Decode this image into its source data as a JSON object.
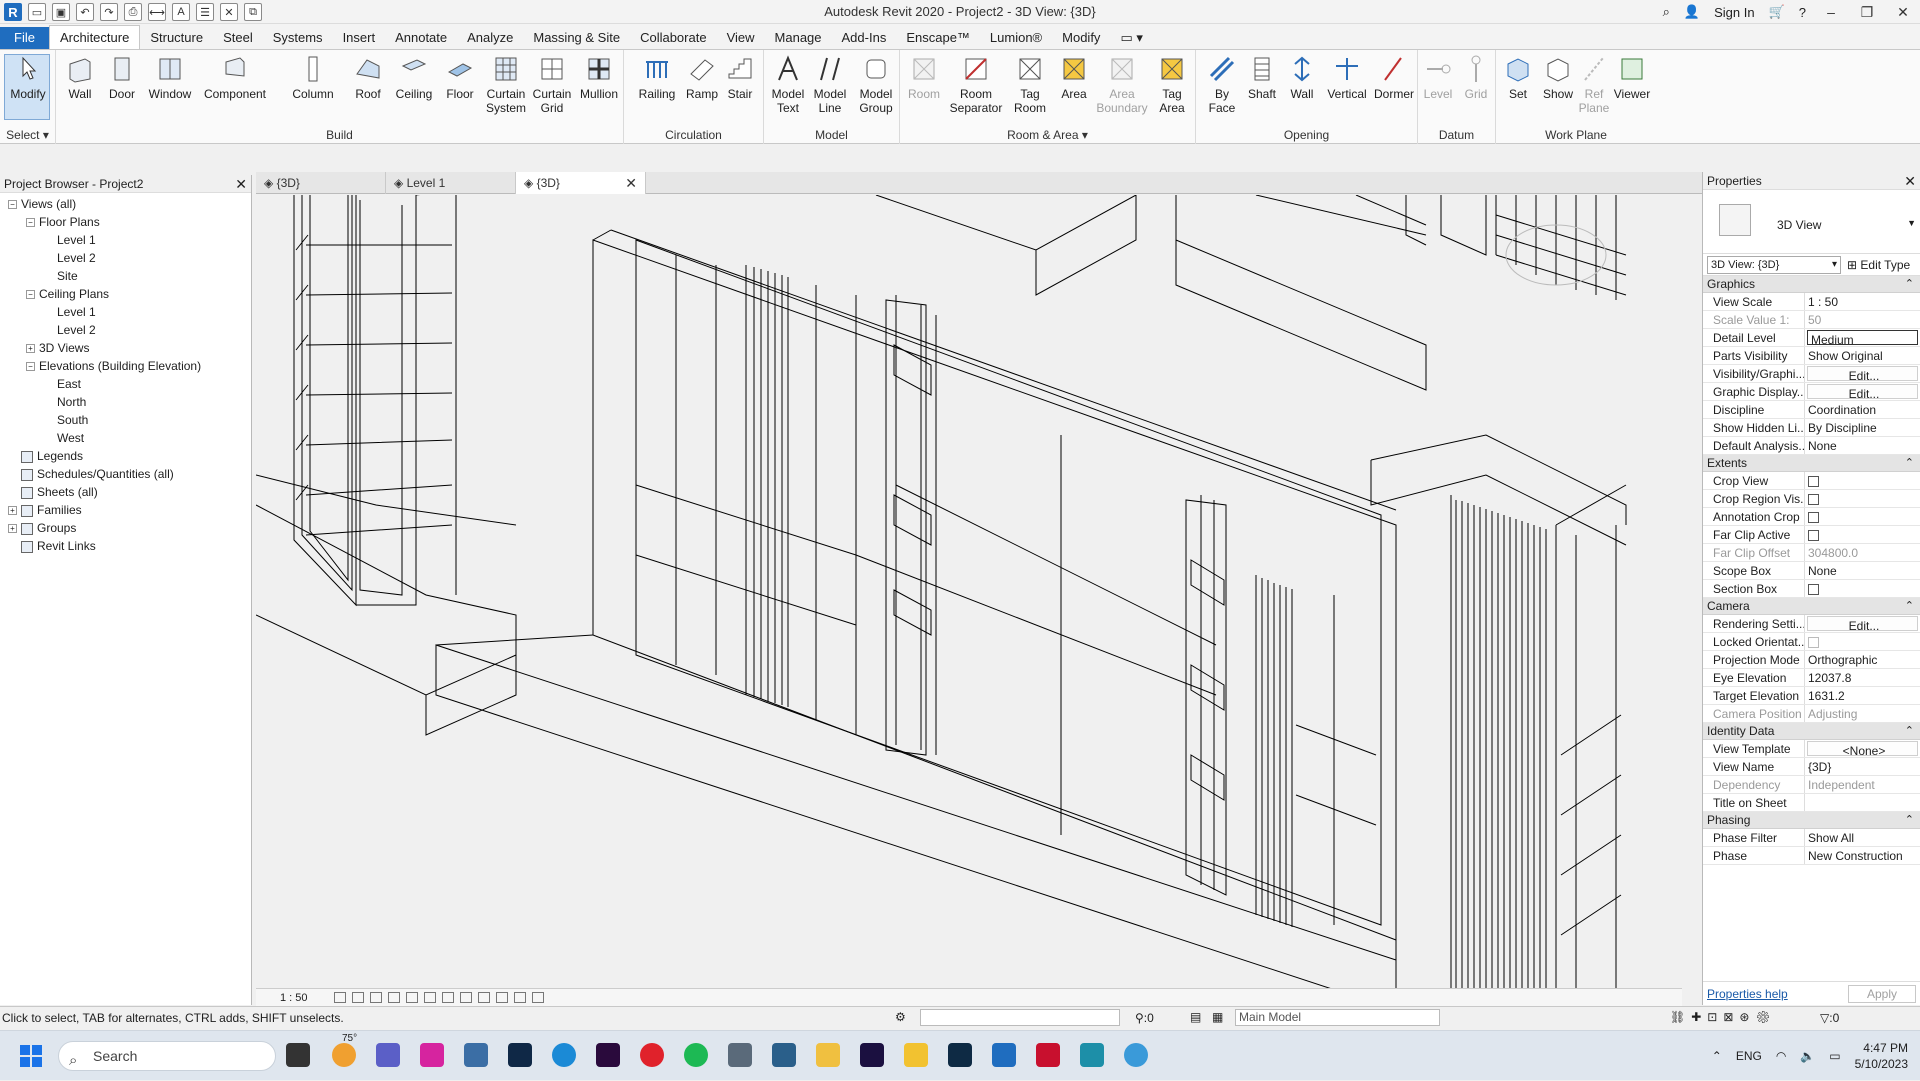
{
  "app": {
    "title": "Autodesk Revit 2020 - Project2 - 3D View: {3D}",
    "sign_in": "Sign In"
  },
  "menu_tabs": [
    "File",
    "Architecture",
    "Structure",
    "Steel",
    "Systems",
    "Insert",
    "Annotate",
    "Analyze",
    "Massing & Site",
    "Collaborate",
    "View",
    "Manage",
    "Add-Ins",
    "Enscape™",
    "Lumion®",
    "Modify"
  ],
  "ribbon": {
    "select": {
      "modify": "Modify",
      "label": "Select"
    },
    "build": {
      "label": "Build",
      "buttons": [
        "Wall",
        "Door",
        "Window",
        "Component",
        "Column",
        "Roof",
        "Ceiling",
        "Floor",
        "Curtain System",
        "Curtain Grid",
        "Mullion"
      ]
    },
    "circulation": {
      "label": "Circulation",
      "buttons": [
        "Railing",
        "Ramp",
        "Stair"
      ]
    },
    "model": {
      "label": "Model",
      "buttons": [
        "Model Text",
        "Model Line",
        "Model Group"
      ]
    },
    "room_area": {
      "label": "Room & Area",
      "buttons": [
        "Room",
        "Room Separator",
        "Tag Room",
        "Area",
        "Area Boundary",
        "Tag Area"
      ]
    },
    "opening": {
      "label": "Opening",
      "buttons": [
        "By Face",
        "Shaft",
        "Wall",
        "Vertical",
        "Dormer"
      ]
    },
    "datum": {
      "label": "Datum",
      "buttons": [
        "Level",
        "Grid"
      ]
    },
    "work_plane": {
      "label": "Work Plane",
      "buttons": [
        "Set",
        "Show",
        "Ref Plane",
        "Viewer"
      ]
    }
  },
  "browser": {
    "title": "Project Browser - Project2",
    "nodes": [
      {
        "label": "Views (all)",
        "level": 0,
        "pm": "−"
      },
      {
        "label": "Floor Plans",
        "level": 1,
        "pm": "−"
      },
      {
        "label": "Level 1",
        "level": 2
      },
      {
        "label": "Level 2",
        "level": 2
      },
      {
        "label": "Site",
        "level": 2
      },
      {
        "label": "Ceiling Plans",
        "level": 1,
        "pm": "−"
      },
      {
        "label": "Level 1",
        "level": 2
      },
      {
        "label": "Level 2",
        "level": 2
      },
      {
        "label": "3D Views",
        "level": 1,
        "pm": "+"
      },
      {
        "label": "Elevations (Building Elevation)",
        "level": 1,
        "pm": "−"
      },
      {
        "label": "East",
        "level": 2
      },
      {
        "label": "North",
        "level": 2
      },
      {
        "label": "South",
        "level": 2
      },
      {
        "label": "West",
        "level": 2
      },
      {
        "label": "Legends",
        "level": 0,
        "icon": true
      },
      {
        "label": "Schedules/Quantities (all)",
        "level": 0,
        "icon": true
      },
      {
        "label": "Sheets (all)",
        "level": 0,
        "icon": true
      },
      {
        "label": "Families",
        "level": 0,
        "pm": "+",
        "icon": true
      },
      {
        "label": "Groups",
        "level": 0,
        "pm": "+",
        "icon": true
      },
      {
        "label": "Revit Links",
        "level": 0,
        "icon": true
      }
    ]
  },
  "view_tabs": [
    {
      "label": "{3D}"
    },
    {
      "label": "Level 1"
    },
    {
      "label": "{3D}",
      "active": true
    }
  ],
  "view_bar": {
    "scale": "1 : 50"
  },
  "properties": {
    "title": "Properties",
    "type_name": "3D View",
    "instance": "3D View: {3D}",
    "edit_type": "Edit Type",
    "sections": [
      {
        "name": "Graphics",
        "rows": [
          [
            "View Scale",
            "1 : 50",
            ""
          ],
          [
            "Scale Value  1:",
            "50",
            "dis"
          ],
          [
            "Detail Level",
            "Medium",
            "sel"
          ],
          [
            "Parts Visibility",
            "Show Original",
            ""
          ],
          [
            "Visibility/Graphi...",
            "Edit...",
            "btn"
          ],
          [
            "Graphic Display...",
            "Edit...",
            "btn"
          ],
          [
            "Discipline",
            "Coordination",
            ""
          ],
          [
            "Show Hidden Li...",
            "By Discipline",
            ""
          ],
          [
            "Default Analysis...",
            "None",
            ""
          ]
        ]
      },
      {
        "name": "Extents",
        "rows": [
          [
            "Crop View",
            "",
            "cb"
          ],
          [
            "Crop Region Vis...",
            "",
            "cb"
          ],
          [
            "Annotation Crop",
            "",
            "cb"
          ],
          [
            "Far Clip Active",
            "",
            "cb"
          ],
          [
            "Far Clip Offset",
            "304800.0",
            "dis"
          ],
          [
            "Scope Box",
            "None",
            ""
          ],
          [
            "Section Box",
            "",
            "cb"
          ]
        ]
      },
      {
        "name": "Camera",
        "rows": [
          [
            "Rendering Setti...",
            "Edit...",
            "btn"
          ],
          [
            "Locked Orientat...",
            "",
            "cbdis"
          ],
          [
            "Projection Mode",
            "Orthographic",
            ""
          ],
          [
            "Eye Elevation",
            "12037.8",
            ""
          ],
          [
            "Target Elevation",
            "1631.2",
            ""
          ],
          [
            "Camera Position",
            "Adjusting",
            "dis"
          ]
        ]
      },
      {
        "name": "Identity Data",
        "rows": [
          [
            "View Template",
            "<None>",
            "btn"
          ],
          [
            "View Name",
            "{3D}",
            ""
          ],
          [
            "Dependency",
            "Independent",
            "dis"
          ],
          [
            "Title on Sheet",
            "",
            ""
          ]
        ]
      },
      {
        "name": "Phasing",
        "rows": [
          [
            "Phase Filter",
            "Show All",
            ""
          ],
          [
            "Phase",
            "New Construction",
            ""
          ]
        ]
      }
    ],
    "help": "Properties help",
    "apply": "Apply"
  },
  "status": {
    "text": "Click to select, TAB for alternates, CTRL adds, SHIFT unselects.",
    "count": ":0",
    "model": "Main Model",
    "filter": ":0"
  },
  "taskbar": {
    "search": "Search",
    "weather": "75°",
    "lang": "ENG",
    "time": "4:47 PM",
    "date": "5/10/2023"
  }
}
